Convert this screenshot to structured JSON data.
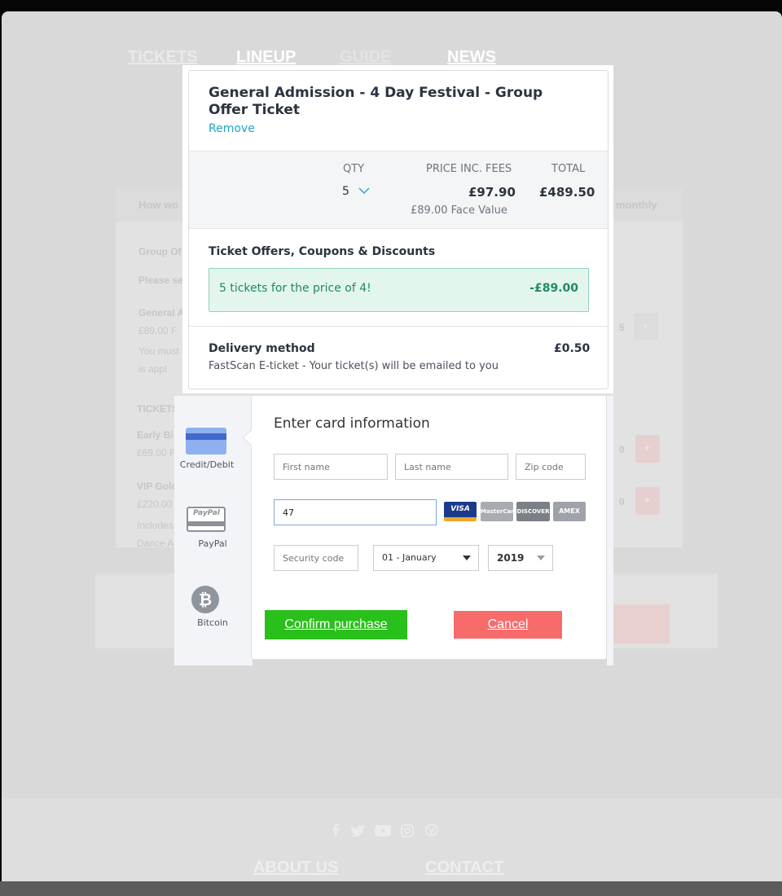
{
  "nav": {
    "items": [
      "TICKETS",
      "LINEUP",
      "GUIDE",
      "NEWS"
    ]
  },
  "background": {
    "header_left": "How wo",
    "header_right": "monthly",
    "lines": [
      "Group Of",
      "Please se",
      "General A",
      "£89.00 F",
      "You must",
      "is appl",
      "TICKETS",
      "Early Bi",
      "£69.00 F",
      "VIP Gold",
      "£220.00",
      "Includes",
      "Dance A"
    ],
    "qty_values": [
      "5",
      "0",
      "0"
    ],
    "plus_label": "+"
  },
  "ticket": {
    "title": "General Admission - 4 Day Festival - Group Offer Ticket",
    "remove_label": "Remove",
    "qty_header": "QTY",
    "price_header": "PRICE INC. FEES",
    "total_header": "TOTAL",
    "qty": "5",
    "price": "£97.90",
    "total": "£489.50",
    "face_value": "£89.00 Face Value",
    "offers_header": "Ticket Offers, Coupons & Discounts",
    "offer_text": "5 tickets for the price of 4!",
    "offer_amount": "-£89.00",
    "delivery_header": "Delivery method",
    "delivery_price": "£0.50",
    "delivery_desc": "FastScan E-ticket - Your ticket(s) will be emailed to you"
  },
  "payment": {
    "methods": [
      {
        "label": "Credit/Debit",
        "icon": "credit-card-icon"
      },
      {
        "label": "PayPal",
        "icon": "paypal-icon"
      },
      {
        "label": "Bitcoin",
        "icon": "bitcoin-icon"
      }
    ],
    "paypal_logo": "PayPal",
    "bitcoin_symbol": "₿",
    "form_title": "Enter card information",
    "first_name_placeholder": "First name",
    "last_name_placeholder": "Last name",
    "zip_placeholder": "Zip code",
    "card_number_value": "47",
    "card_logos": [
      "VISA",
      "MasterCard",
      "DISCOVER",
      "AMEX"
    ],
    "security_placeholder": "Security code",
    "month_selected": "01 - January",
    "year_selected": "2019",
    "confirm_label": "Confirm purchase",
    "cancel_label": "Cancel"
  },
  "footer": {
    "links": [
      "ABOUT US",
      "CONTACT"
    ]
  },
  "colors": {
    "accent_link": "#1fa6c8",
    "confirm": "#29c01b",
    "cancel": "#f76b6b",
    "offer_bg": "#e3f6ee"
  }
}
